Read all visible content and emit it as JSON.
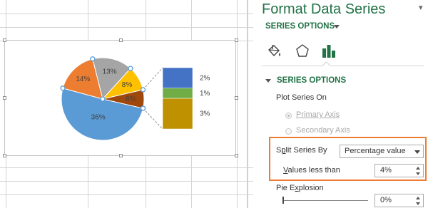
{
  "pane": {
    "title": "Format Data Series",
    "series_options_dropdown": "SERIES OPTIONS",
    "icons": [
      "paint-bucket-icon",
      "pentagon-effects-icon",
      "bar-chart-options-icon"
    ],
    "section_title": "SERIES OPTIONS",
    "plot_series_on_label": "Plot Series On",
    "primary_axis_label": "Primary Axis",
    "secondary_axis_label": "Secondary Axis",
    "split_series_by_label_pre": "S",
    "split_series_by_label_u": "p",
    "split_series_by_label_post": "lit Series By",
    "split_series_by_value": "Percentage value",
    "values_less_than_label_u": "V",
    "values_less_than_label_post": "alues less than",
    "values_less_than_value": "4%",
    "pie_explosion_label_pre": "Pie E",
    "pie_explosion_label_u": "x",
    "pie_explosion_label_post": "plosion",
    "pie_explosion_value": "0%",
    "pie_explosion_fraction": 0,
    "highlight_color": "#ED7D31",
    "accent_color": "#217346"
  },
  "chart_data": {
    "type": "pie",
    "subtype": "bar-of-pie",
    "pie": {
      "slices": [
        {
          "label": "36%",
          "value": 36,
          "color": "#5B9BD5"
        },
        {
          "label": "14%",
          "value": 14,
          "color": "#ED7D31"
        },
        {
          "label": "13%",
          "value": 13,
          "color": "#A5A5A5"
        },
        {
          "label": "8%",
          "value": 8,
          "color": "#FFC000"
        },
        {
          "label": "6%",
          "value": 6,
          "color": "#9E480E"
        }
      ]
    },
    "bar": {
      "segments": [
        {
          "label": "3%",
          "value": 3,
          "color": "#BF9000"
        },
        {
          "label": "1%",
          "value": 1,
          "color": "#70AD47"
        },
        {
          "label": "2%",
          "value": 2,
          "color": "#4472C4"
        }
      ]
    }
  }
}
